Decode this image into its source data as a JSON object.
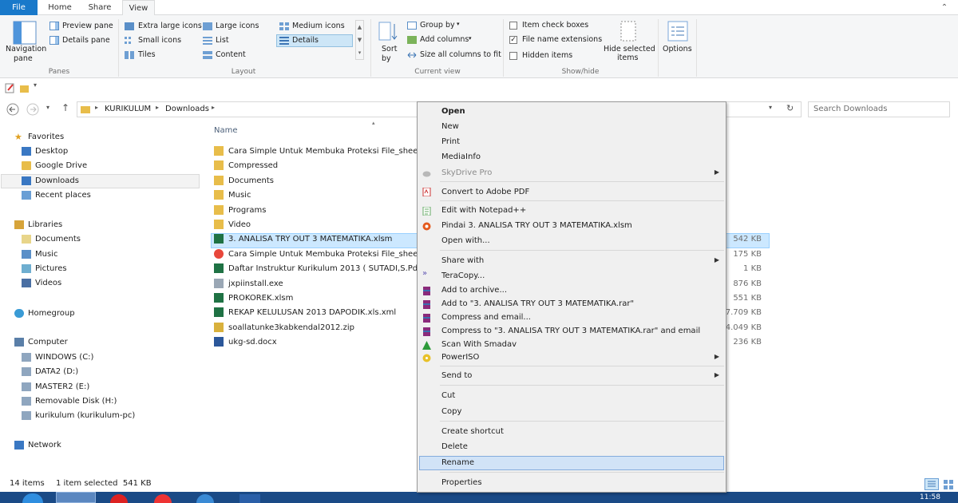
{
  "ribbon": {
    "tabs": [
      "File",
      "Home",
      "Share",
      "View"
    ],
    "panes": {
      "navigation_pane": "Navigation",
      "navigation_pane2": "pane",
      "preview_pane": "Preview pane",
      "details_pane": "Details pane",
      "label": "Panes"
    },
    "layout": {
      "extra_large": "Extra large icons",
      "large": "Large icons",
      "medium": "Medium icons",
      "small": "Small icons",
      "list": "List",
      "details": "Details",
      "tiles": "Tiles",
      "content": "Content",
      "label": "Layout"
    },
    "current_view": {
      "sort": "Sort",
      "sort2": "by",
      "group_by": "Group by",
      "add_columns": "Add columns",
      "size_all": "Size all columns to fit",
      "label": "Current view"
    },
    "show_hide": {
      "item_check": "Item check boxes",
      "file_ext": "File name extensions",
      "hidden": "Hidden items",
      "hide_selected": "Hide selected",
      "hide_selected2": "items",
      "label": "Show/hide"
    },
    "options": "Options"
  },
  "address": {
    "crumbs": [
      "KURIKULUM",
      "Downloads"
    ],
    "search_placeholder": "Search Downloads"
  },
  "nav": {
    "favorites": "Favorites",
    "desktop": "Desktop",
    "gdrive": "Google Drive",
    "downloads": "Downloads",
    "recent": "Recent places",
    "libraries": "Libraries",
    "documents": "Documents",
    "music": "Music",
    "pictures": "Pictures",
    "videos": "Videos",
    "homegroup": "Homegroup",
    "computer": "Computer",
    "c": "WINDOWS (C:)",
    "d": "DATA2 (D:)",
    "e": "MASTER2 (E:)",
    "h": "Removable Disk (H:)",
    "net_drive": "kurikulum (kurikulum-pc)",
    "network": "Network"
  },
  "columns": {
    "name": "Name"
  },
  "files": [
    {
      "name": "Cara Simple Untuk Membuka Proteksi File_sheet Ex",
      "size": "",
      "icon": "folder"
    },
    {
      "name": "Compressed",
      "size": "",
      "icon": "folder"
    },
    {
      "name": "Documents",
      "size": "",
      "icon": "folder"
    },
    {
      "name": "Music",
      "size": "",
      "icon": "folder"
    },
    {
      "name": "Programs",
      "size": "",
      "icon": "folder"
    },
    {
      "name": "Video",
      "size": "",
      "icon": "folder"
    },
    {
      "name": "3. ANALISA TRY OUT 3 MATEMATIKA.xlsm",
      "size": "542 KB",
      "icon": "excel"
    },
    {
      "name": "Cara Simple Untuk Membuka Proteksi File_sheet Ex",
      "size": "175 KB",
      "icon": "chrome"
    },
    {
      "name": "Daftar Instruktur Kurikulum 2013 ( SUTADI,S.Pd).xls",
      "size": "1 KB",
      "icon": "excel"
    },
    {
      "name": "jxpiinstall.exe",
      "size": "876 KB",
      "icon": "exe"
    },
    {
      "name": "PROKOREK.xlsm",
      "size": "551 KB",
      "icon": "excel"
    },
    {
      "name": "REKAP KELULUSAN 2013 DAPODIK.xls.xml",
      "size": "17.709 KB",
      "icon": "excel"
    },
    {
      "name": "soallatunke3kabkendal2012.zip",
      "size": "4.049 KB",
      "icon": "zip"
    },
    {
      "name": "ukg-sd.docx",
      "size": "236 KB",
      "icon": "word"
    }
  ],
  "menu": {
    "open": "Open",
    "new": "New",
    "print": "Print",
    "mediainfo": "MediaInfo",
    "skydrive": "SkyDrive Pro",
    "pdf": "Convert to Adobe PDF",
    "notepad": "Edit with Notepad++",
    "pindai": "Pindai 3. ANALISA TRY OUT 3 MATEMATIKA.xlsm",
    "openwith": "Open with...",
    "sharewith": "Share with",
    "teracopy": "TeraCopy...",
    "addarchive": "Add to archive...",
    "addrar": "Add to \"3. ANALISA TRY OUT 3 MATEMATIKA.rar\"",
    "compressemail": "Compress and email...",
    "compressrar": "Compress to \"3. ANALISA TRY OUT 3 MATEMATIKA.rar\" and email",
    "smadav": "Scan With Smadav",
    "poweriso": "PowerISO",
    "sendto": "Send to",
    "cut": "Cut",
    "copy": "Copy",
    "shortcut": "Create shortcut",
    "delete": "Delete",
    "rename": "Rename",
    "properties": "Properties"
  },
  "status": {
    "count": "14 items",
    "selected": "1 item selected  541 KB"
  },
  "clock": "11:58"
}
